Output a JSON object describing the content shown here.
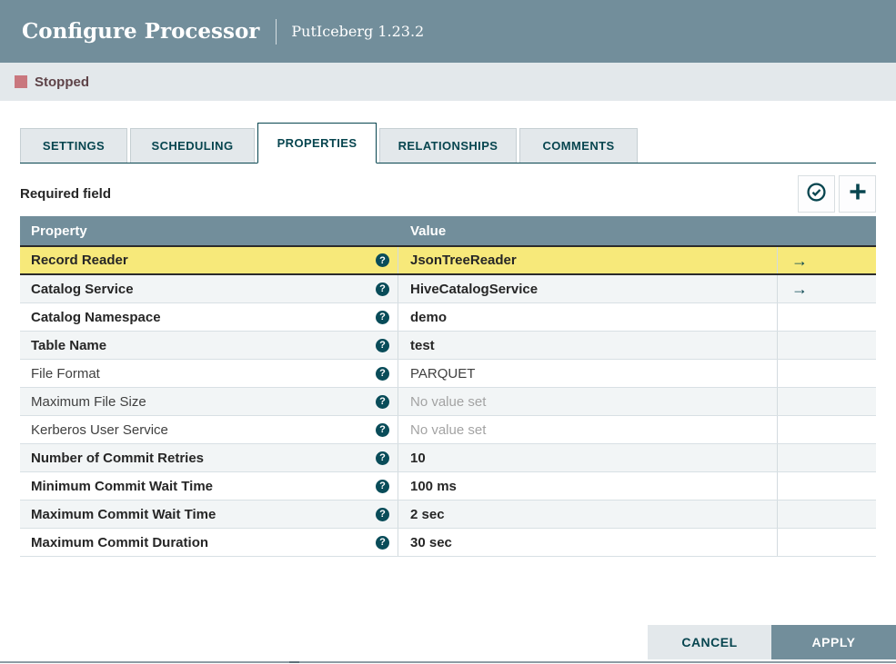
{
  "dialog": {
    "title": "Configure Processor",
    "subtitle": "PutIceberg 1.23.2",
    "status": "Stopped"
  },
  "tabs": [
    {
      "label": "SETTINGS",
      "active": false
    },
    {
      "label": "SCHEDULING",
      "active": false
    },
    {
      "label": "PROPERTIES",
      "active": true
    },
    {
      "label": "RELATIONSHIPS",
      "active": false
    },
    {
      "label": "COMMENTS",
      "active": false
    }
  ],
  "properties_panel": {
    "required_field_label": "Required field",
    "toolbar_icons": {
      "verify": "verify-properties-check-circle-icon",
      "add": "add-property-plus-icon"
    },
    "table": {
      "columns": {
        "property": "Property",
        "value": "Value"
      },
      "help_icon_glyph": "?",
      "go_to_arrow_glyph": "→",
      "rows": [
        {
          "property": "Record Reader",
          "value": "JsonTreeReader",
          "required": true,
          "selected": true,
          "has_go_to_arrow": true,
          "value_set": true
        },
        {
          "property": "Catalog Service",
          "value": "HiveCatalogService",
          "required": true,
          "selected": false,
          "has_go_to_arrow": true,
          "value_set": true
        },
        {
          "property": "Catalog Namespace",
          "value": "demo",
          "required": true,
          "selected": false,
          "has_go_to_arrow": false,
          "value_set": true
        },
        {
          "property": "Table Name",
          "value": "test",
          "required": true,
          "selected": false,
          "has_go_to_arrow": false,
          "value_set": true
        },
        {
          "property": "File Format",
          "value": "PARQUET",
          "required": false,
          "selected": false,
          "has_go_to_arrow": false,
          "value_set": true
        },
        {
          "property": "Maximum File Size",
          "value": "No value set",
          "required": false,
          "selected": false,
          "has_go_to_arrow": false,
          "value_set": false
        },
        {
          "property": "Kerberos User Service",
          "value": "No value set",
          "required": false,
          "selected": false,
          "has_go_to_arrow": false,
          "value_set": false
        },
        {
          "property": "Number of Commit Retries",
          "value": "10",
          "required": true,
          "selected": false,
          "has_go_to_arrow": false,
          "value_set": true
        },
        {
          "property": "Minimum Commit Wait Time",
          "value": "100 ms",
          "required": true,
          "selected": false,
          "has_go_to_arrow": false,
          "value_set": true
        },
        {
          "property": "Maximum Commit Wait Time",
          "value": "2 sec",
          "required": true,
          "selected": false,
          "has_go_to_arrow": false,
          "value_set": true
        },
        {
          "property": "Maximum Commit Duration",
          "value": "30 sec",
          "required": true,
          "selected": false,
          "has_go_to_arrow": false,
          "value_set": true
        }
      ]
    }
  },
  "footer": {
    "cancel_label": "CANCEL",
    "apply_label": "APPLY"
  },
  "colors": {
    "header_bg": "#728E9B",
    "status_bar_bg": "#E3E8EB",
    "stopped_square": "#C9777E",
    "stopped_text": "#5E4348",
    "accent_teal": "#07454F",
    "selected_row_bg": "#F7E97A",
    "alt_row_bg": "#F2F5F6",
    "table_header_bg": "#728E9B",
    "unset_value_text": "#A3A3A3"
  }
}
